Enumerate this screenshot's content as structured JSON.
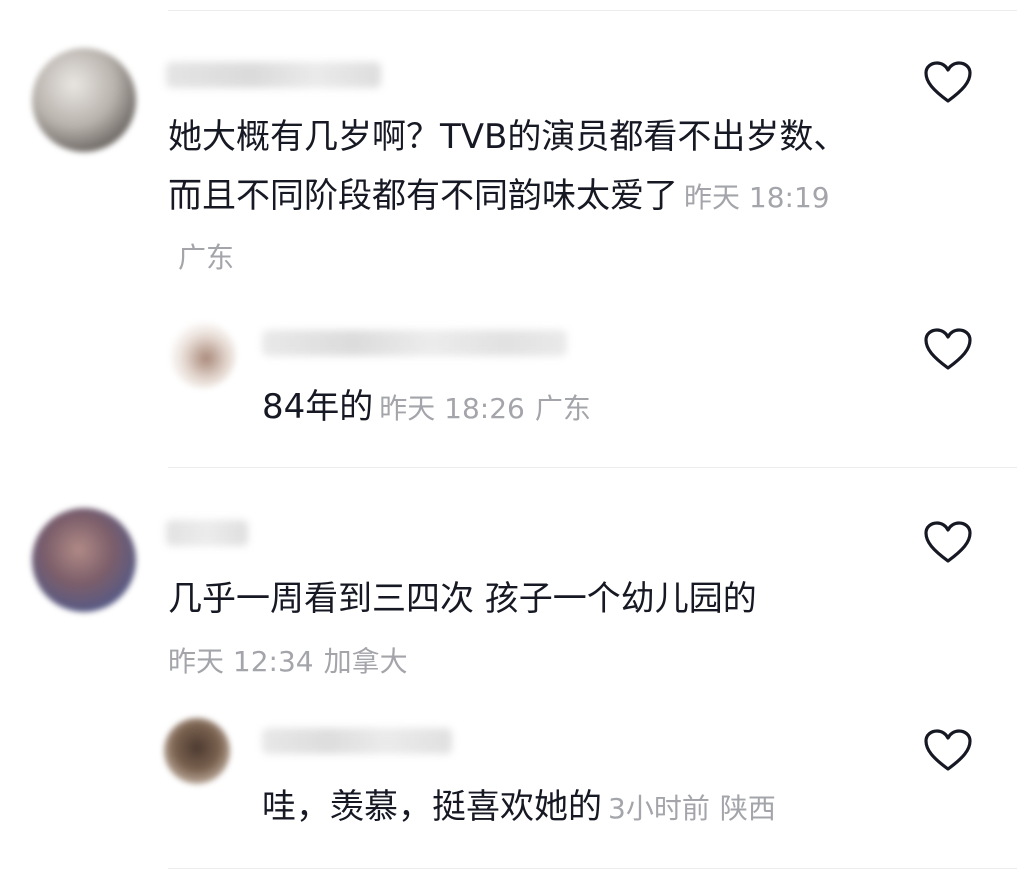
{
  "comments": [
    {
      "text": "她大概有几岁啊？TVB的演员都看不出岁数、而且不同阶段都有不同韵味太爱了",
      "time": "昨天 18:19",
      "location": "广东",
      "reply": {
        "text": "84年的",
        "time": "昨天 18:26",
        "location": "广东"
      }
    },
    {
      "text": "几乎一周看到三四次 孩子一个幼儿园的",
      "time": "昨天 12:34",
      "location": "加拿大",
      "reply": {
        "text": "哇，羡慕，挺喜欢她的",
        "time": "3小时前",
        "location": "陕西"
      }
    }
  ],
  "icons": {
    "like": "heart-outline-icon"
  },
  "colors": {
    "text": "#161823",
    "meta": "#a3a5aa",
    "divider": "#ececec"
  }
}
